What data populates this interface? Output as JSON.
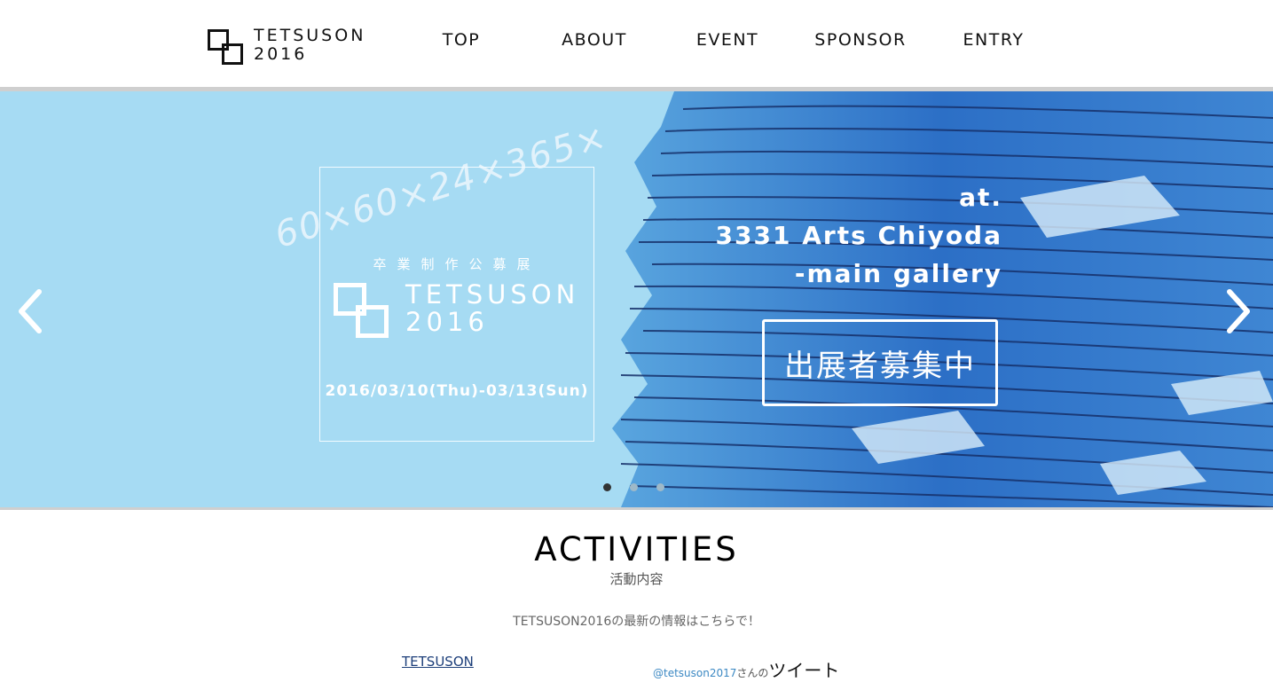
{
  "header": {
    "logo": {
      "line1": "TETSUSON",
      "line2": "2016"
    },
    "nav": [
      "TOP",
      "ABOUT",
      "EVENT",
      "SPONSOR",
      "ENTRY"
    ]
  },
  "hero": {
    "math_text": "60×60×24×365×",
    "event_box": {
      "subtitle": "卒業制作公募展",
      "title_line1": "TETSUSON",
      "title_line2": "2016",
      "dates": "2016/03/10(Thu)-03/13(Sun)"
    },
    "venue": {
      "line1": "at.",
      "line2": "3331 Arts Chiyoda",
      "line3": "-main gallery"
    },
    "cta_label": "出展者募集中",
    "carousel": {
      "slide_count": 3,
      "active_index": 0
    },
    "arrow_icons": {
      "prev": "chevron-left-icon",
      "next": "chevron-right-icon"
    }
  },
  "activities": {
    "title": "ACTIVITIES",
    "subtitle": "活動内容",
    "info": "TETSUSON2016の最新の情報はこちらで！",
    "twitter_link": "TETSUSON",
    "tweets_handle": "@tetsuson2017",
    "tweets_suffix": "さんの",
    "tweets_label": "ツイート"
  },
  "colors": {
    "hero_light_blue": "#a6dbf3",
    "paper_blue": "#2f73c8",
    "dot_active": "#333333",
    "dot_inactive": "#9fb9c8",
    "link_blue": "#1d3f7a"
  }
}
